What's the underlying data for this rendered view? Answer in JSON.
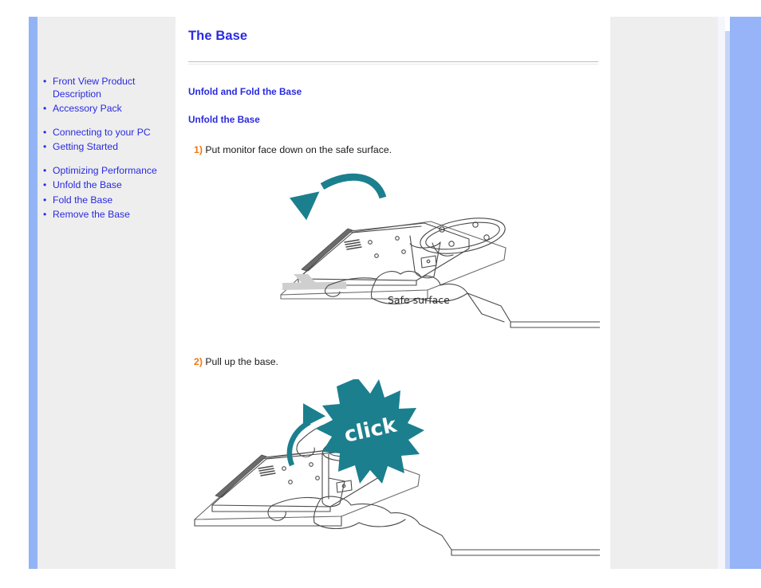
{
  "colors": {
    "link_blue": "#2a2ae0",
    "panel_bar_blue": "#92b4f4",
    "panel_gray": "#eeeeee",
    "step_number_orange": "#f07814",
    "illustration_teal": "#1b7f8e",
    "line_art_gray": "#4a4a4a"
  },
  "sidebar": {
    "groups": [
      {
        "items": [
          {
            "label": "Front View Product Description",
            "name": "front-view-product-description"
          },
          {
            "label": "Accessory Pack",
            "name": "accessory-pack"
          }
        ]
      },
      {
        "items": [
          {
            "label": "Connecting to your PC",
            "name": "connecting-to-your-pc"
          },
          {
            "label": "Getting Started",
            "name": "getting-started"
          }
        ]
      },
      {
        "items": [
          {
            "label": "Optimizing Performance",
            "name": "optimizing-performance"
          },
          {
            "label": "Unfold the Base",
            "name": "unfold-the-base"
          },
          {
            "label": "Fold the Base",
            "name": "fold-the-base"
          },
          {
            "label": "Remove the Base",
            "name": "remove-the-base"
          }
        ]
      }
    ],
    "bullet": "•"
  },
  "main": {
    "title": "The Base",
    "sub_head_1": "Unfold and Fold the Base",
    "sub_head_2": "Unfold the Base",
    "steps": [
      {
        "number": "1)",
        "text": "Put monitor face down on the safe surface.",
        "figure": {
          "name": "monitor-face-down-illustration",
          "caption": "Safe surface",
          "arrow": "curved-down-arrow"
        }
      },
      {
        "number": "2)",
        "text": "Pull up the base.",
        "figure": {
          "name": "pull-up-base-illustration",
          "caption": "",
          "burst_label": "click",
          "arrow": "curved-up-arrow"
        }
      }
    ]
  }
}
